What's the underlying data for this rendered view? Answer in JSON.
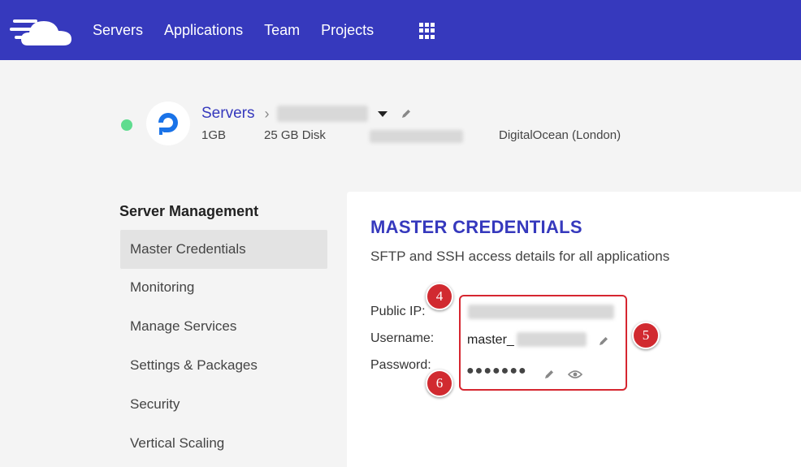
{
  "nav": {
    "items": [
      {
        "label": "Servers"
      },
      {
        "label": "Applications"
      },
      {
        "label": "Team"
      },
      {
        "label": "Projects"
      }
    ],
    "background": "#3639bd"
  },
  "server": {
    "status_color": "#5fdc8f",
    "breadcrumb_root": "Servers",
    "size": "1GB",
    "disk": "25 GB Disk",
    "provider": "DigitalOcean (London)"
  },
  "sidebar": {
    "title": "Server Management",
    "items": [
      {
        "label": "Master Credentials",
        "active": true
      },
      {
        "label": "Monitoring"
      },
      {
        "label": "Manage Services"
      },
      {
        "label": "Settings & Packages"
      },
      {
        "label": "Security"
      },
      {
        "label": "Vertical Scaling"
      }
    ]
  },
  "credentials": {
    "title": "MASTER CREDENTIALS",
    "subtitle": "SFTP and SSH access details for all applications",
    "public_ip_label": "Public IP:",
    "username_label": "Username:",
    "password_label": "Password:",
    "username_prefix": "master_",
    "password_mask": "●●●●●●●",
    "highlight_color": "#d62630"
  },
  "badges": [
    "4",
    "5",
    "6"
  ]
}
